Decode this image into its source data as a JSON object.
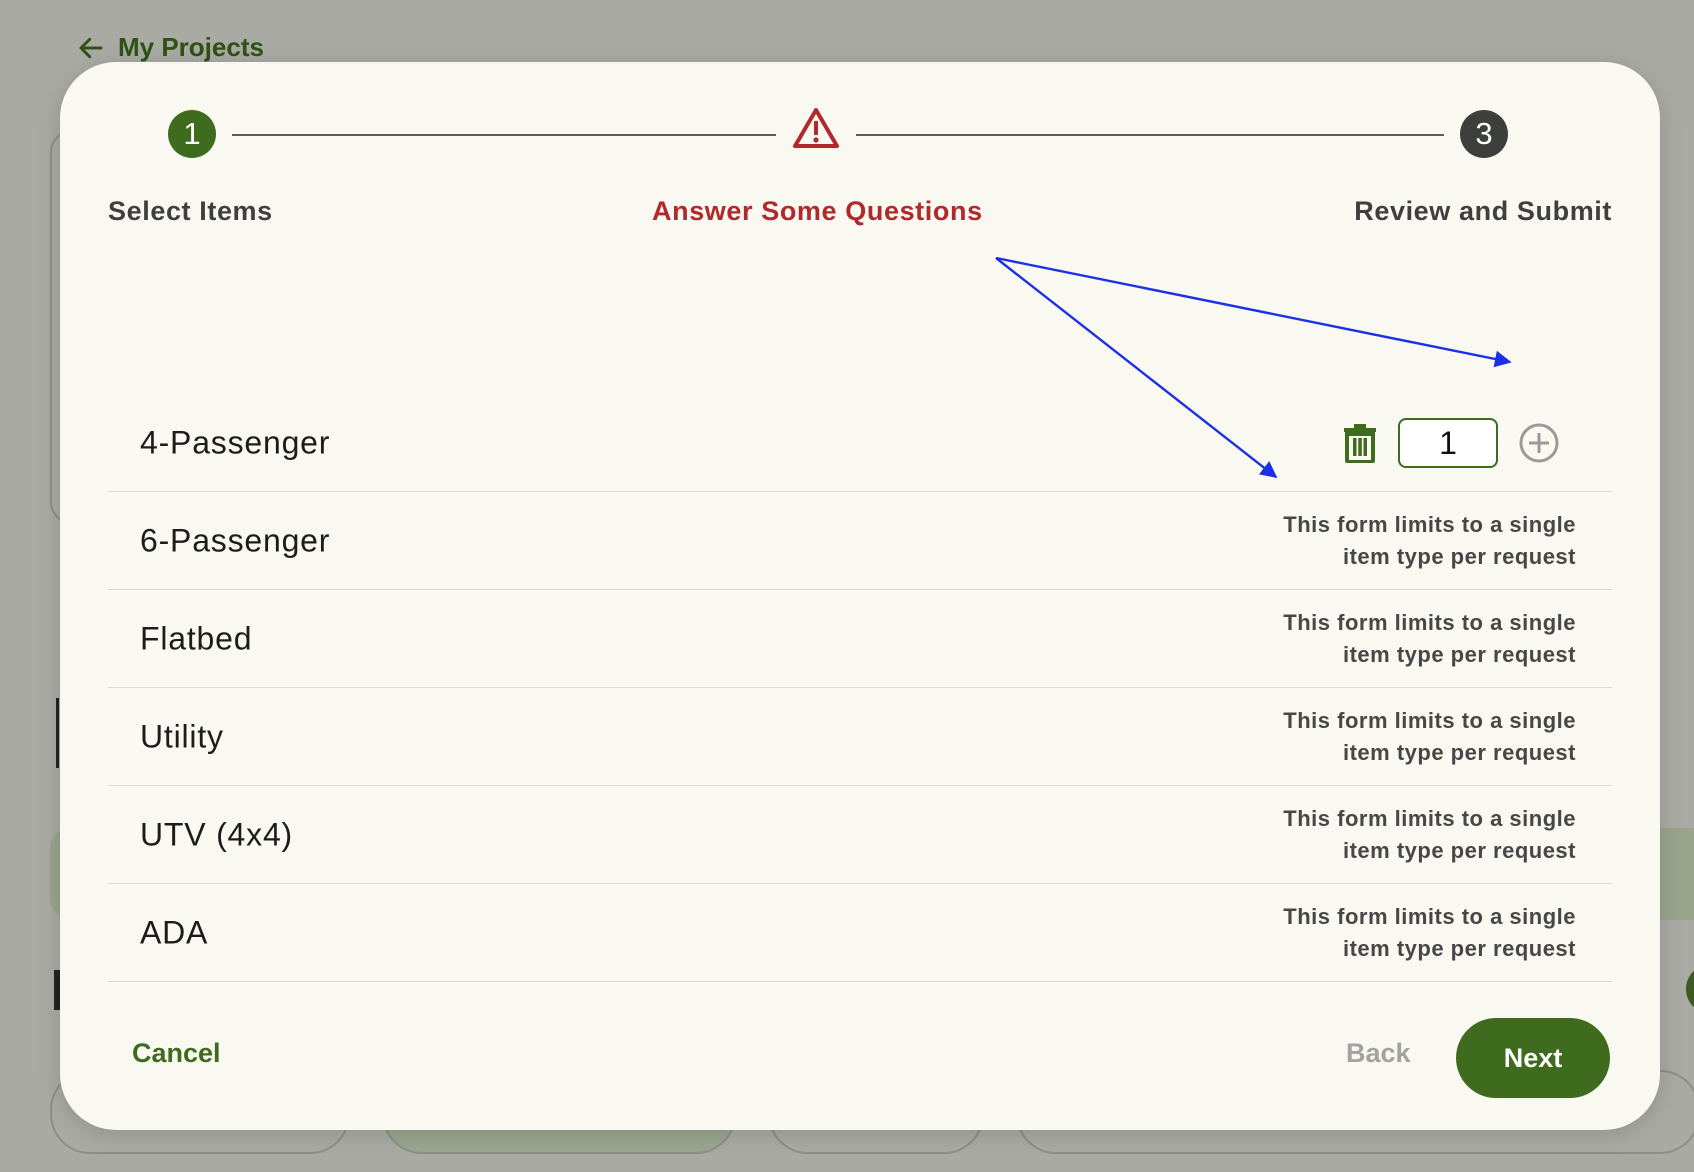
{
  "background": {
    "back_link": "My Projects"
  },
  "stepper": {
    "step1": {
      "number": "1",
      "label": "Select Items"
    },
    "step2": {
      "label": "Answer Some Questions",
      "status": "warning"
    },
    "step3": {
      "number": "3",
      "label": "Review and Submit"
    }
  },
  "items": [
    {
      "name": "4-Passenger",
      "quantity": "1",
      "selected": true
    },
    {
      "name": "6-Passenger",
      "note": "This form limits to a single item type per request"
    },
    {
      "name": "Flatbed",
      "note": "This form limits to a single item type per request"
    },
    {
      "name": "Utility",
      "note": "This form limits to a single item type per request"
    },
    {
      "name": "UTV (4x4)",
      "note": "This form limits to a single item type per request"
    },
    {
      "name": "ADA",
      "note": "This form limits to a single item type per request"
    }
  ],
  "footer": {
    "cancel_label": "Cancel",
    "back_label": "Back",
    "next_label": "Next"
  },
  "colors": {
    "primary": "#3e6b1d",
    "error": "#b0292b",
    "annotation": "#1a2fe6"
  }
}
